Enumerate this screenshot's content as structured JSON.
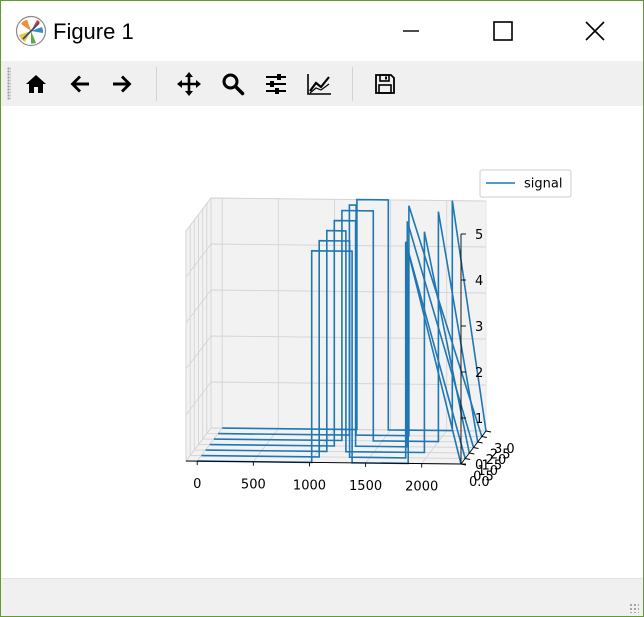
{
  "window": {
    "title": "Figure 1",
    "controls": {
      "minimize": "minimize",
      "maximize": "maximize",
      "close": "close"
    }
  },
  "toolbar": {
    "buttons": [
      {
        "name": "home",
        "icon": "home-icon",
        "tooltip": "Reset original view"
      },
      {
        "name": "back",
        "icon": "arrow-left-icon",
        "tooltip": "Back to previous view"
      },
      {
        "name": "forward",
        "icon": "arrow-right-icon",
        "tooltip": "Forward to next view"
      },
      {
        "name": "pan",
        "icon": "move-icon",
        "tooltip": "Pan axes"
      },
      {
        "name": "zoom",
        "icon": "magnifier-icon",
        "tooltip": "Zoom to rectangle"
      },
      {
        "name": "subplots",
        "icon": "sliders-icon",
        "tooltip": "Configure subplots"
      },
      {
        "name": "customize",
        "icon": "line-chart-icon",
        "tooltip": "Edit axis, curve and image parameters"
      },
      {
        "name": "save",
        "icon": "floppy-disk-icon",
        "tooltip": "Save the figure"
      }
    ]
  },
  "chart_data": {
    "type": "line",
    "projection": "3d",
    "title": "",
    "xlabel": "",
    "ylabel": "",
    "zlabel": "",
    "x_ticks": [
      "0",
      "500",
      "1000",
      "1500",
      "2000"
    ],
    "y_ticks": [
      "0.0",
      "0.5",
      "1.0",
      "1.5",
      "2.0",
      "2.5",
      "3.0"
    ],
    "z_ticks": [
      "0",
      "1",
      "2",
      "3",
      "4",
      "5"
    ],
    "xlim": [
      -100,
      2350
    ],
    "ylim": [
      0,
      3
    ],
    "zlim": [
      0,
      5
    ],
    "legend": {
      "entries": [
        "signal"
      ],
      "placement": "top-right"
    },
    "grid": true,
    "series": [
      {
        "name": "signal",
        "color": "#1f77b4",
        "segments": [
          {
            "y": 0.0,
            "x": [
              0,
              1020,
              1020,
              1380,
              1380,
              1880,
              1880,
              2350
            ],
            "z": [
              0,
              0,
              4.6,
              4.6,
              0,
              0,
              4.6,
              0
            ]
          },
          {
            "y": 0.5,
            "x": [
              0,
              1050,
              1050,
              1320,
              1320,
              1820,
              1820,
              2350
            ],
            "z": [
              0,
              0,
              4.7,
              4.7,
              0,
              0,
              4.7,
              0
            ]
          },
          {
            "y": 1.0,
            "x": [
              0,
              1080,
              1080,
              1250,
              1250,
              1950,
              1950,
              2350
            ],
            "z": [
              0,
              0,
              4.8,
              4.8,
              0,
              0,
              4.8,
              0
            ]
          },
          {
            "y": 1.5,
            "x": [
              0,
              1110,
              1110,
              1300,
              1300,
              1760,
              1760,
              2350
            ],
            "z": [
              0,
              0,
              4.9,
              4.9,
              0,
              0,
              4.9,
              0
            ]
          },
          {
            "y": 2.0,
            "x": [
              0,
              1140,
              1140,
              1420,
              1420,
              2000,
              2000,
              2350
            ],
            "z": [
              0,
              0,
              5.0,
              5.0,
              0,
              0,
              5.0,
              0
            ]
          },
          {
            "y": 2.5,
            "x": [
              0,
              1170,
              1170,
              1230,
              1230,
              1700,
              1700,
              2350
            ],
            "z": [
              0,
              0,
              5.0,
              5.0,
              0,
              0,
              5.0,
              0
            ]
          },
          {
            "y": 3.0,
            "x": [
              0,
              1200,
              1200,
              1480,
              1480,
              2050,
              2050,
              2350
            ],
            "z": [
              0,
              0,
              5.0,
              5.0,
              0,
              0,
              5.0,
              0
            ]
          }
        ]
      }
    ]
  }
}
